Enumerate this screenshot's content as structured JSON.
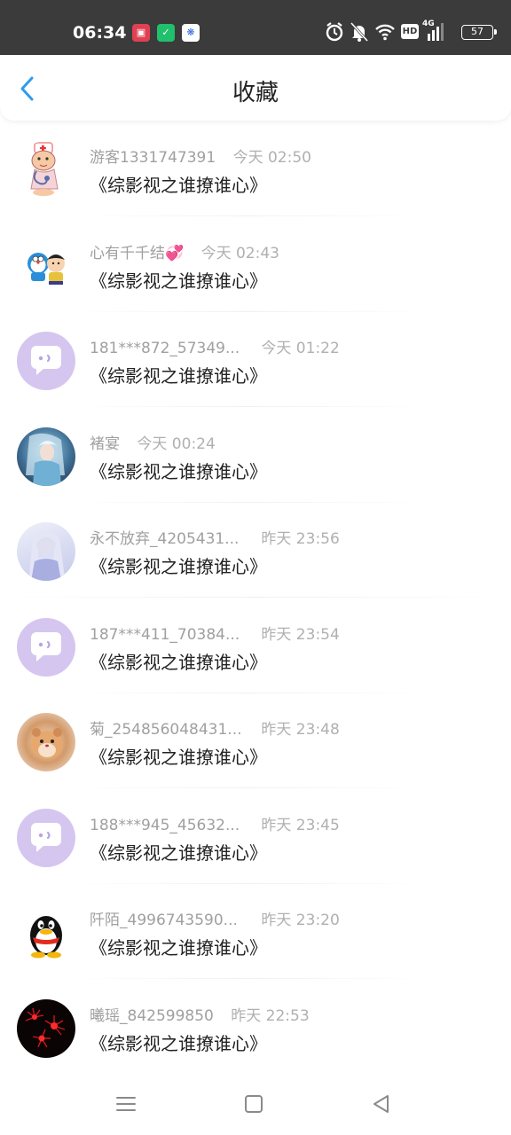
{
  "status_bar": {
    "time": "06:34",
    "network_label": "HD",
    "signal_label": "4G",
    "battery": "57"
  },
  "header": {
    "title": "收藏",
    "back_icon": "chevron-left-icon",
    "accent": "#2e9bf0"
  },
  "items": [
    {
      "name": "游客1331747391",
      "time": "今天 02:50",
      "title": "《综影视之谁撩谁心》",
      "avatar": "nurse-cartoon"
    },
    {
      "name": "心有千千结💞",
      "time": "今天 02:43",
      "title": "《综影视之谁撩谁心》",
      "avatar": "doraemon-cartoon"
    },
    {
      "name": "181***872_57349...",
      "time": "今天 01:22",
      "title": "《综影视之谁撩谁心》",
      "avatar": "default-chat"
    },
    {
      "name": "褚宴",
      "time": "今天 00:24",
      "title": "《综影视之谁撩谁心》",
      "avatar": "fantasy-character"
    },
    {
      "name": "永不放弃_4205431...",
      "time": "昨天 23:56",
      "title": "《综影视之谁撩谁心》",
      "avatar": "anime-girl"
    },
    {
      "name": "187***411_70384...",
      "time": "昨天 23:54",
      "title": "《综影视之谁撩谁心》",
      "avatar": "default-chat"
    },
    {
      "name": "菊_254856048431...",
      "time": "昨天 23:48",
      "title": "《综影视之谁撩谁心》",
      "avatar": "hamster"
    },
    {
      "name": "188***945_45632...",
      "time": "昨天 23:45",
      "title": "《综影视之谁撩谁心》",
      "avatar": "default-chat"
    },
    {
      "name": "阡陌_4996743590...",
      "time": "昨天 23:20",
      "title": "《综影视之谁撩谁心》",
      "avatar": "qq-penguin"
    },
    {
      "name": "曦瑶_842599850",
      "time": "昨天 22:53",
      "title": "《综影视之谁撩谁心》",
      "avatar": "red-flowers"
    }
  ],
  "nav": {
    "menu_icon": "menu-icon",
    "home_icon": "home-square-icon",
    "back_icon": "back-triangle-icon"
  }
}
